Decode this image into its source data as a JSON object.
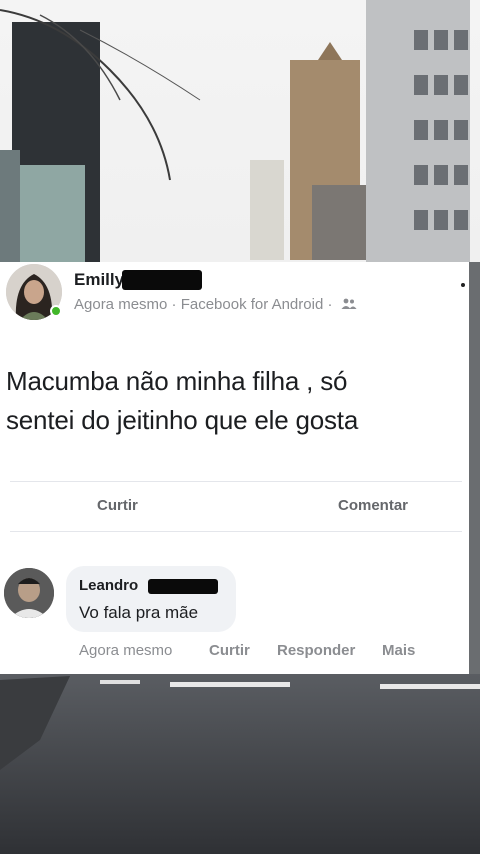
{
  "post": {
    "author": "Emilly",
    "meta": "Agora mesmo · Facebook for Android ·",
    "privacy_icon": "friends-icon",
    "text_line1": "Macumba não minha filha , só",
    "text_line2": "sentei do jeitinho que ele gosta",
    "actions": {
      "like": "Curtir",
      "comment": "Comentar"
    }
  },
  "comment": {
    "author": "Leandro",
    "text": "Vo fala pra mãe",
    "time": "Agora mesmo",
    "like": "Curtir",
    "reply": "Responder",
    "more": "Mais"
  },
  "colors": {
    "online": "#42b72a",
    "text": "#1c1e21",
    "muted": "#8b8d91"
  }
}
